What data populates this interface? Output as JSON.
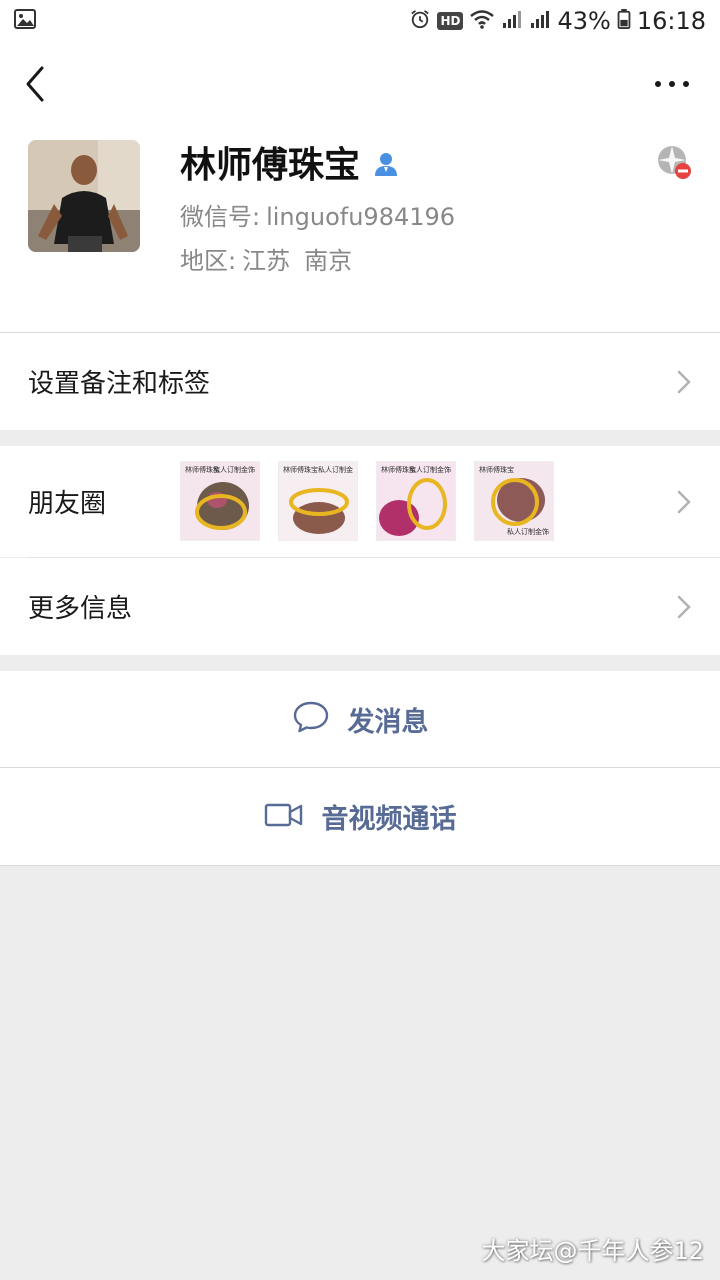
{
  "status_bar": {
    "battery": "43%",
    "time": "16:18",
    "hd_label": "HD",
    "icons": [
      "gallery-icon",
      "alarm-icon",
      "hd-icon",
      "wifi-icon",
      "signal-icon",
      "signal-4g-icon",
      "battery-icon"
    ]
  },
  "topbar": {
    "back_icon": "back-arrow-icon",
    "more_icon": "more-dots-icon"
  },
  "profile": {
    "name": "林师傅珠宝",
    "wechat_id_label": "微信号:",
    "wechat_id": "linguofu984196",
    "region_label": "地区:",
    "province": "江苏",
    "city": "南京",
    "verify_icon": "verified-user-icon",
    "star_icon": "star-friend-blocked-icon"
  },
  "menu": {
    "remark_tags": "设置备注和标签",
    "moments": "朋友圈",
    "more_info": "更多信息"
  },
  "moments_thumbs": [
    {
      "caption_left": "林师傅珠宝",
      "caption_right": "私人订制金饰"
    },
    {
      "caption_left": "林师傅珠宝",
      "caption_right": "私人订制金"
    },
    {
      "caption_left": "林师傅珠宝",
      "caption_right": "私人订制金饰"
    },
    {
      "caption_left": "林师傅珠宝",
      "caption_right": "私人订制金饰"
    }
  ],
  "actions": {
    "send_message": "发消息",
    "video_call": "音视频通话"
  },
  "watermark": "大家坛@千年人参12",
  "colors": {
    "link_blue": "#576b95",
    "background": "#ededed",
    "verify_blue": "#4a90e2",
    "blocked_red": "#e64340"
  }
}
